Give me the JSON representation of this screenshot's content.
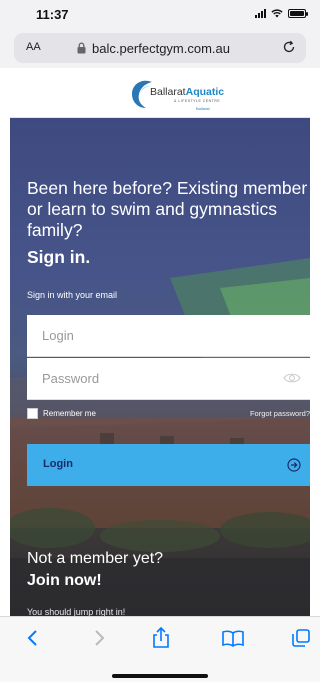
{
  "status_bar": {
    "time": "11:37",
    "icons": [
      "signal-icon",
      "wifi-icon",
      "battery-icon"
    ]
  },
  "browser": {
    "aa_label": "AA",
    "url": "balc.perfectgym.com.au",
    "icons": [
      "lock-icon",
      "reload-icon"
    ]
  },
  "logo": {
    "name_plain": "Ballarat",
    "name_bold": "Aquatic",
    "subtitle": "& LIFESTYLE CENTRE",
    "council": "Ballarat"
  },
  "login": {
    "intro": "Been here before? Existing member or learn to swim and gymnastics family?",
    "title": "Sign in.",
    "sign_with": "Sign in with your email",
    "login_placeholder": "Login",
    "password_placeholder": "Password",
    "remember_me": "Remember me",
    "forgot_password": "Forgot password?",
    "login_button": "Login"
  },
  "signup": {
    "prompt": "Not a member yet?",
    "join": "Join now!",
    "subtext": "You should jump right in!"
  },
  "toolbar": {
    "items": [
      "back-icon",
      "forward-icon",
      "share-icon",
      "bookmarks-icon",
      "tabs-icon"
    ]
  },
  "colors": {
    "accent": "#3daee9",
    "accent_text": "#1b2a6b",
    "ios_blue": "#007aff",
    "hero_top": "#3e4a7f"
  }
}
